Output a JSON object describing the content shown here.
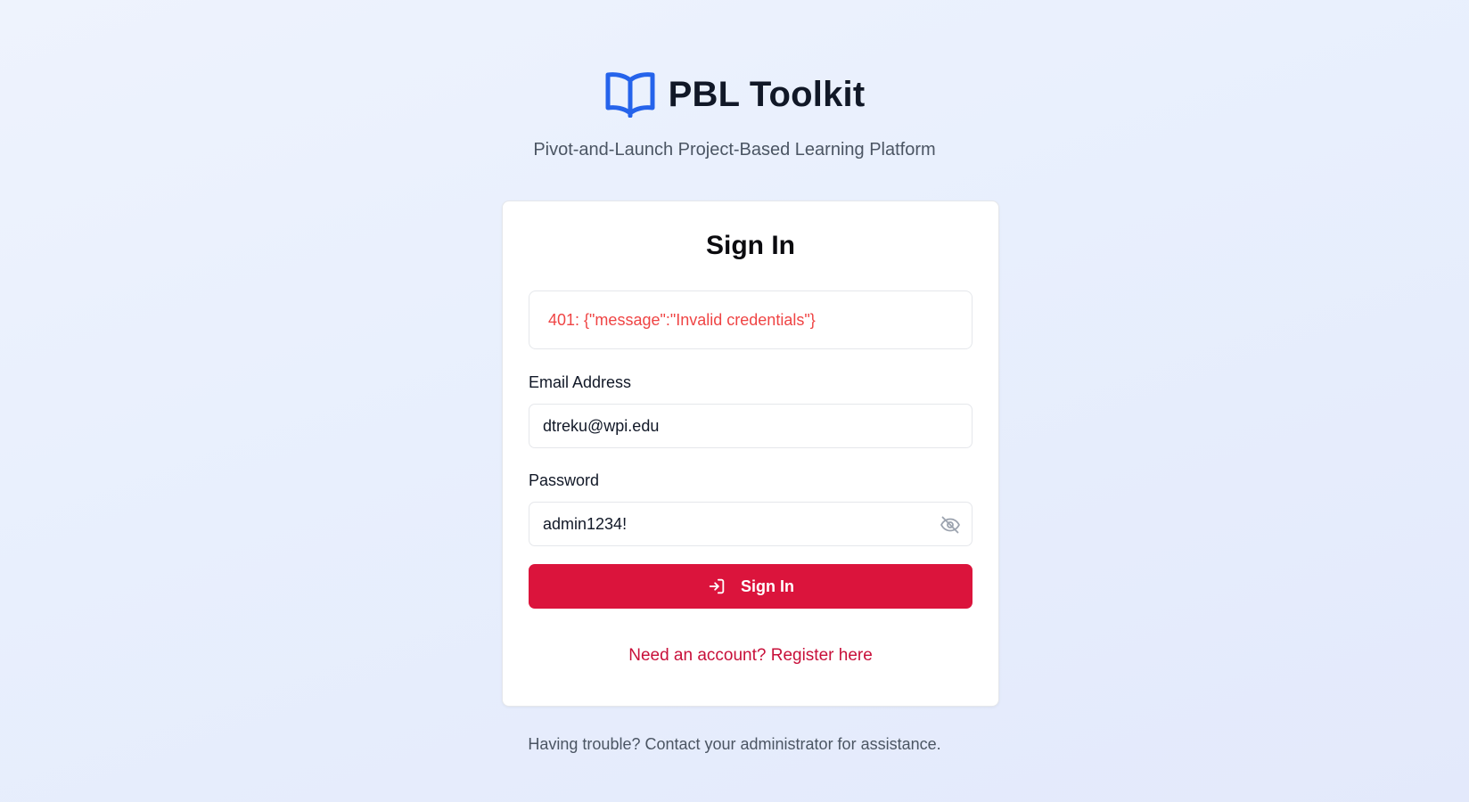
{
  "header": {
    "title": "PBL Toolkit",
    "logo_icon": "open-book-icon",
    "tagline": "Pivot-and-Launch Project-Based Learning Platform"
  },
  "signin_card": {
    "title": "Sign In",
    "error_message": "401: {\"message\":\"Invalid credentials\"}",
    "email": {
      "label": "Email Address",
      "value": "dtreku@wpi.edu"
    },
    "password": {
      "label": "Password",
      "value": "admin1234!",
      "toggle_icon": "eye-off-icon"
    },
    "submit": {
      "label": "Sign In",
      "icon": "sign-in-arrow-icon"
    },
    "register_link": "Need an account? Register here"
  },
  "footer": {
    "note": "Having trouble? Contact your administrator for assistance."
  },
  "colors": {
    "primary": "#db143c",
    "link": "#c8103a",
    "error": "#ef4444",
    "brand_icon": "#2563eb"
  }
}
